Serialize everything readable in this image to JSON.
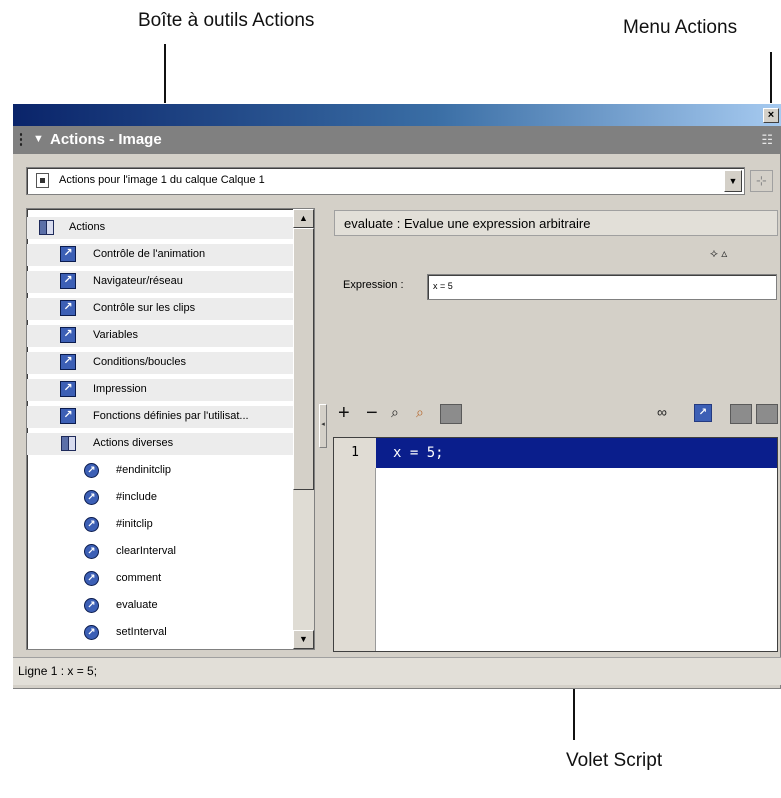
{
  "annotations": {
    "toolbox": "Boîte à outils Actions",
    "menu": "Menu Actions",
    "script": "Volet Script"
  },
  "window": {
    "close_glyph": "×",
    "panel_title": "Actions - Image",
    "collapse_glyph": "▼",
    "menu_glyph": "☷"
  },
  "target": {
    "label": "Actions pour l'image 1 du calque Calque 1",
    "dropdown_glyph": "▼",
    "pin_glyph": "⊹"
  },
  "toolbox": {
    "root": "Actions",
    "categories": [
      "Contrôle de l'animation",
      "Navigateur/réseau",
      "Contrôle sur les clips",
      "Variables",
      "Conditions/boucles",
      "Impression",
      "Fonctions définies par l'utilisat..."
    ],
    "open_category": "Actions diverses",
    "items": [
      "#endinitclip",
      "#include",
      "#initclip",
      "clearInterval",
      "comment",
      "evaluate",
      "setInterval"
    ],
    "scroll_up_glyph": "▲",
    "scroll_down_glyph": "▼",
    "item_glyph": "↗"
  },
  "params": {
    "description": "evaluate : Evalue une expression arbitraire",
    "expression_label": "Expression :",
    "expression_value": "x = 5",
    "icons": "⟡ ▵"
  },
  "editor_toolbar": {
    "add": "+",
    "remove": "−",
    "find": "⌕",
    "replace": "⌕",
    "target_path": "∞",
    "ref": "↗"
  },
  "script": {
    "line_number": "1",
    "code": "x = 5;"
  },
  "status": {
    "text": "Ligne 1 : x = 5;"
  },
  "colors": {
    "selection": "#0a1e8c",
    "panel_gray": "#d4d0c8",
    "titlebar_blue": "#0a246a"
  }
}
